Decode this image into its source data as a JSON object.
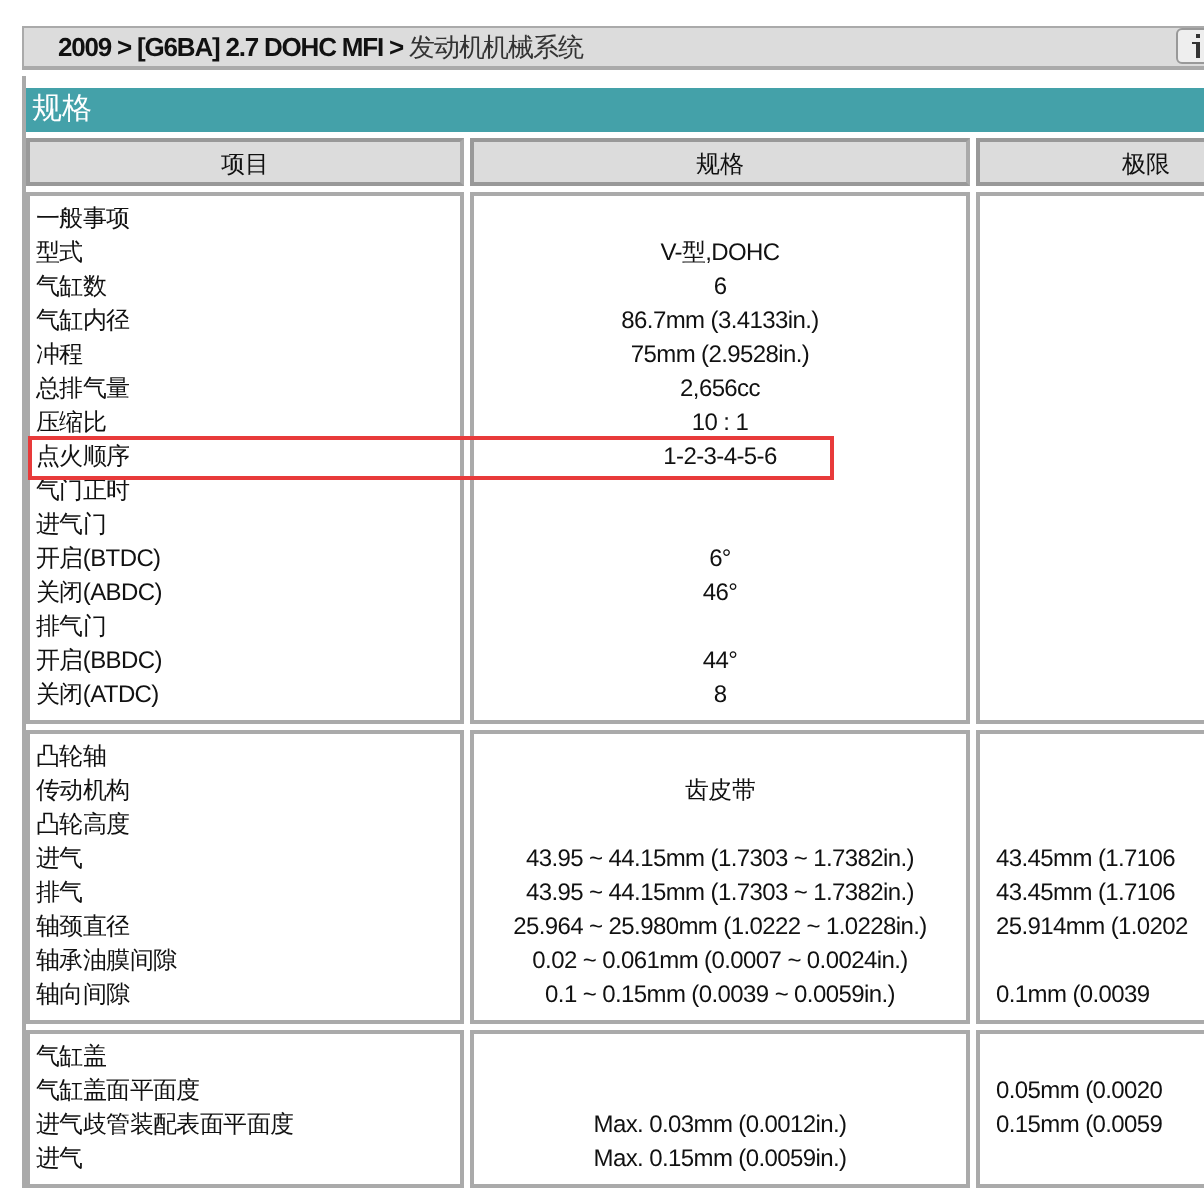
{
  "breadcrumb": {
    "path": "2009 > [G6BA] 2.7 DOHC MFI >",
    "current": "发动机机械系统"
  },
  "section_title": "规格",
  "table": {
    "columns": [
      "项目",
      "规格",
      "极限"
    ],
    "sections": [
      {
        "rows": [
          {
            "item": "一般事项",
            "highlighted": false
          },
          {
            "item": "型式",
            "spec": "V-型,DOHC",
            "highlighted": false
          },
          {
            "item": "气缸数",
            "spec": "6",
            "highlighted": false
          },
          {
            "item": "气缸内径",
            "spec": "86.7mm (3.4133in.)",
            "highlighted": false
          },
          {
            "item": "冲程",
            "spec": "75mm (2.9528in.)",
            "highlighted": false
          },
          {
            "item": "总排气量",
            "spec": "2,656cc",
            "highlighted": false
          },
          {
            "item": "压缩比",
            "spec": "10 : 1",
            "highlighted": false
          },
          {
            "item": "点火顺序",
            "spec": "1-2-3-4-5-6",
            "highlighted": true
          },
          {
            "item": "气门正时",
            "highlighted": false
          },
          {
            "item": "进气门",
            "highlighted": false
          },
          {
            "item": "开启(BTDC)",
            "spec": "6°",
            "highlighted": false
          },
          {
            "item": "关闭(ABDC)",
            "spec": "46°",
            "highlighted": false
          },
          {
            "item": "排气门",
            "highlighted": false
          },
          {
            "item": "开启(BBDC)",
            "spec": "44°",
            "highlighted": false
          },
          {
            "item": "关闭(ATDC)",
            "spec": "8",
            "highlighted": false
          }
        ]
      },
      {
        "rows": [
          {
            "item": "凸轮轴",
            "highlighted": false
          },
          {
            "item": "传动机构",
            "spec": "齿皮带",
            "highlighted": false
          },
          {
            "item": "凸轮高度",
            "highlighted": false
          },
          {
            "item": "进气",
            "spec": "43.95 ~ 44.15mm (1.7303 ~ 1.7382in.)",
            "limit": "43.45mm (1.7106",
            "highlighted": false
          },
          {
            "item": "排气",
            "spec": "43.95 ~ 44.15mm (1.7303 ~ 1.7382in.)",
            "limit": "43.45mm (1.7106",
            "highlighted": false
          },
          {
            "item": "轴颈直径",
            "spec": "25.964 ~ 25.980mm (1.0222 ~ 1.0228in.)",
            "limit": "25.914mm (1.0202",
            "highlighted": false
          },
          {
            "item": "轴承油膜间隙",
            "spec": "0.02 ~ 0.061mm (0.0007 ~ 0.0024in.)",
            "highlighted": false
          },
          {
            "item": "轴向间隙",
            "spec": "0.1 ~ 0.15mm (0.0039 ~ 0.0059in.)",
            "limit": "0.1mm (0.0039",
            "highlighted": false
          }
        ]
      },
      {
        "rows": [
          {
            "item": "气缸盖",
            "highlighted": false
          },
          {
            "item": "气缸盖面平面度",
            "limit": "0.05mm (0.0020",
            "highlighted": false
          },
          {
            "item": "进气歧管装配表面平面度",
            "spec": "Max. 0.03mm (0.0012in.)",
            "limit": "0.15mm (0.0059",
            "highlighted": false
          },
          {
            "item": "进气",
            "spec": "Max. 0.15mm (0.0059in.)",
            "highlighted": false
          }
        ]
      }
    ]
  }
}
